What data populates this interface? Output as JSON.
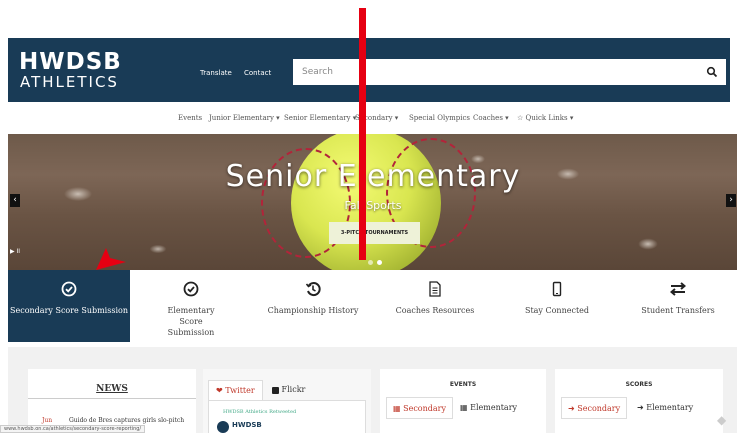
{
  "header": {
    "logo_top": "HWDSB",
    "logo_bottom": "ATHLETICS",
    "links": [
      "Translate",
      "Contact"
    ],
    "search_placeholder": "Search",
    "bg_color": "#193b56"
  },
  "nav": {
    "items": [
      "Events",
      "Junior Elementary ▾",
      "Senior Elementary ▾",
      "Secondary ▾",
      "Special Olympics",
      "Coaches ▾",
      "☆ Quick Links ▾"
    ]
  },
  "hero": {
    "title": "Senior Elementary",
    "subtitle": "Fall Sports",
    "button": "3-PITCH TOURNAMENTS",
    "prev": "‹",
    "next": "›",
    "pause": "▶ II",
    "slide_count": 2,
    "active_slide": 1
  },
  "quick_links": [
    {
      "label": "Secondary Score Submission",
      "icon": "check-circle-icon",
      "active": true
    },
    {
      "label": "Elementary Score Submission",
      "icon": "check-circle-icon",
      "active": false
    },
    {
      "label": "Championship History",
      "icon": "history-icon",
      "active": false
    },
    {
      "label": "Coaches Resources",
      "icon": "document-icon",
      "active": false
    },
    {
      "label": "Stay Connected",
      "icon": "mobile-icon",
      "active": false
    },
    {
      "label": "Student Transfers",
      "icon": "exchange-icon",
      "active": false
    }
  ],
  "news": {
    "title": "NEWS",
    "date": "Jun",
    "headline": "Guido de Bres captures girls slo-pitch"
  },
  "social": {
    "tabs": [
      "Twitter",
      "Flickr"
    ],
    "tweet_header": "HWDSB Athletics Retweeted",
    "tweet_user": "HWDSB"
  },
  "events": {
    "title": "EVENTS",
    "tabs": [
      "Secondary",
      "Elementary"
    ]
  },
  "scores": {
    "title": "SCORES",
    "tabs": [
      "Secondary",
      "Elementary"
    ]
  },
  "status_url": "www.hwdsb.on.ca/athletics/secondary-score-reporting/",
  "colors": {
    "navy": "#193b56",
    "accent_red": "#c0392b",
    "annotation_red": "#e60012"
  }
}
